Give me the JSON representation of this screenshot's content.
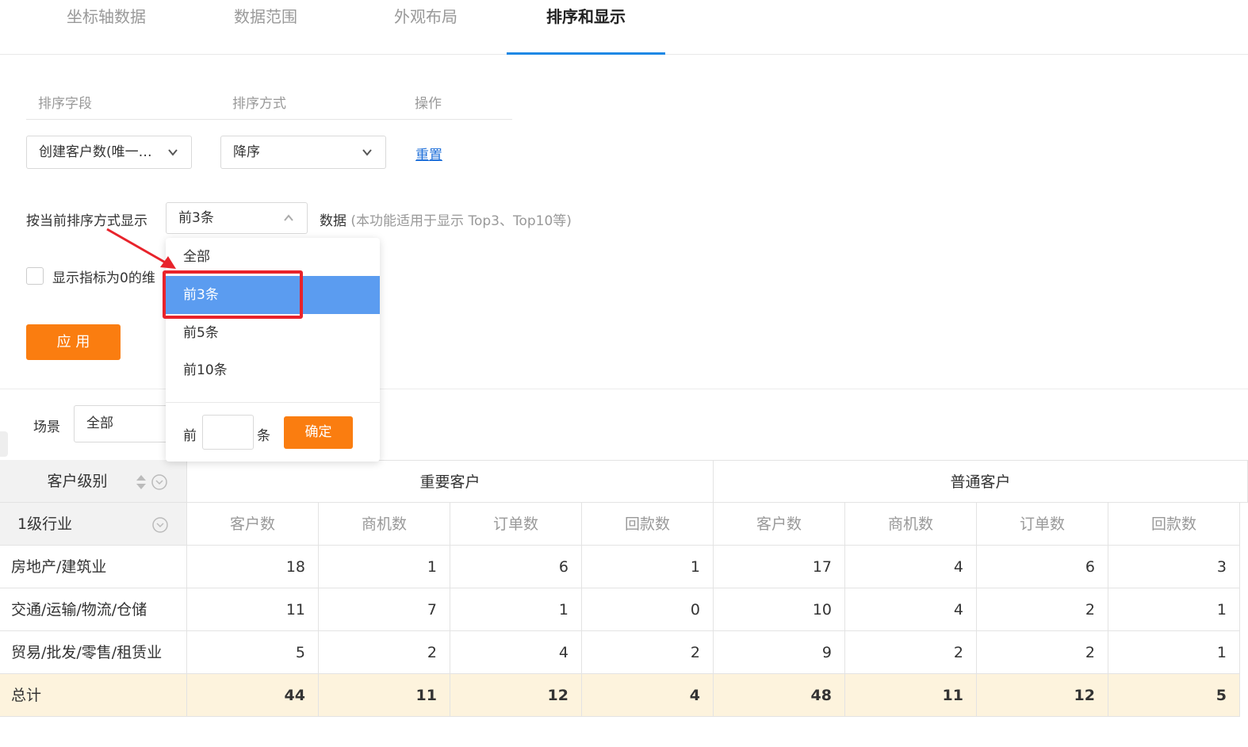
{
  "tabs": [
    {
      "label": "坐标轴数据"
    },
    {
      "label": "数据范围"
    },
    {
      "label": "外观布局"
    },
    {
      "label": "排序和显示"
    }
  ],
  "sort": {
    "headers": {
      "field": "排序字段",
      "method": "排序方式",
      "action": "操作"
    },
    "field_value": "创建客户数(唯一…",
    "method_value": "降序",
    "reset_label": "重置"
  },
  "display": {
    "label": "按当前排序方式显示",
    "selected": "前3条",
    "suffix": "数据",
    "hint": "(本功能适用于显示 Top3、Top10等)"
  },
  "checkbox": {
    "label": "显示指标为0的维"
  },
  "apply_label": "应 用",
  "dropdown": {
    "options": [
      "全部",
      "前3条",
      "前5条",
      "前10条"
    ],
    "selected_index": 1,
    "custom_prefix": "前",
    "custom_suffix": "条",
    "confirm_label": "确定"
  },
  "scene": {
    "label": "场景",
    "value": "全部"
  },
  "colors": {
    "accent": "#1e88e5",
    "orange": "#fa7d10",
    "selected": "#5b9cf0",
    "highlight": "#e8232b",
    "total_bg": "#fdf3dd"
  },
  "table": {
    "row_dim_header": "客户级别",
    "col_dim_header": "1级行业",
    "groups": [
      "重要客户",
      "普通客户"
    ],
    "measures": [
      "客户数",
      "商机数",
      "订单数",
      "回款数",
      "客户数",
      "商机数",
      "订单数",
      "回款数"
    ],
    "rows": [
      {
        "name": "房地产/建筑业",
        "values": [
          "18",
          "1",
          "6",
          "1",
          "17",
          "4",
          "6",
          "3"
        ]
      },
      {
        "name": "交通/运输/物流/仓储",
        "values": [
          "11",
          "7",
          "1",
          "0",
          "10",
          "4",
          "2",
          "1"
        ]
      },
      {
        "name": "贸易/批发/零售/租赁业",
        "values": [
          "5",
          "2",
          "4",
          "2",
          "9",
          "2",
          "2",
          "1"
        ]
      }
    ],
    "total": {
      "name": "总计",
      "values": [
        "44",
        "11",
        "12",
        "4",
        "48",
        "11",
        "12",
        "5"
      ]
    }
  }
}
